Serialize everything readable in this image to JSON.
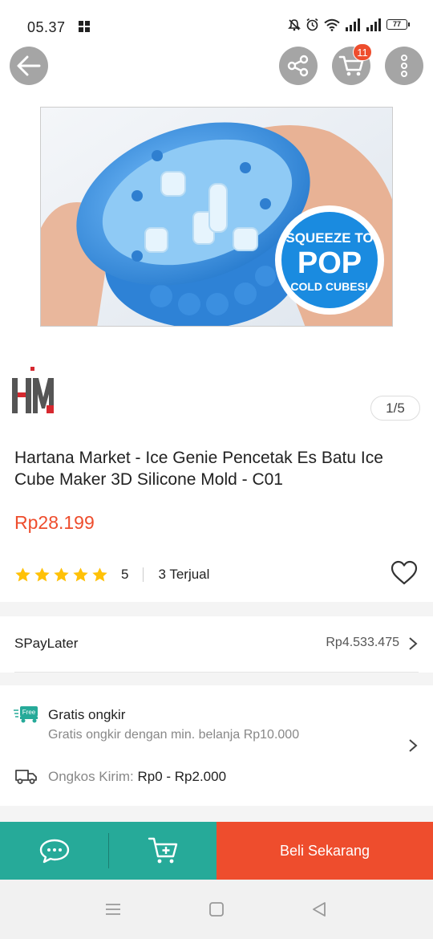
{
  "status_bar": {
    "time": "05.37",
    "battery": "77",
    "icons": [
      "notifications-muted-icon",
      "alarm-icon",
      "wifi-icon",
      "signal-icon",
      "signal-icon",
      "battery-icon"
    ]
  },
  "header": {
    "cart_badge": "11",
    "icons": [
      "back-arrow-icon",
      "share-icon",
      "cart-icon",
      "more-vertical-icon"
    ]
  },
  "product_image": {
    "overlay_lines": [
      "SQUEEZE TO",
      "POP",
      "COLD CUBES!"
    ]
  },
  "gallery": {
    "counter": "1/5"
  },
  "store": {
    "logo_text": "HM"
  },
  "product": {
    "title": "Hartana Market - Ice Genie Pencetak Es Batu Ice Cube Maker 3D Silicone Mold - C01",
    "price": "Rp28.199",
    "rating": "5",
    "stars": 5,
    "sold": "3 Terjual"
  },
  "spaylater": {
    "label": "SPayLater",
    "amount": "Rp4.533.475"
  },
  "shipping": {
    "free_badge": "Free",
    "title": "Gratis ongkir",
    "subtitle": "Gratis ongkir dengan min. belanja Rp10.000",
    "cost_label": "Ongkos Kirim:",
    "cost_value": "Rp0 - Rp2.000"
  },
  "actions": {
    "buy_now": "Beli Sekarang"
  },
  "colors": {
    "accent": "#ee4d2d",
    "teal": "#26aa99",
    "star": "#ffc107"
  }
}
